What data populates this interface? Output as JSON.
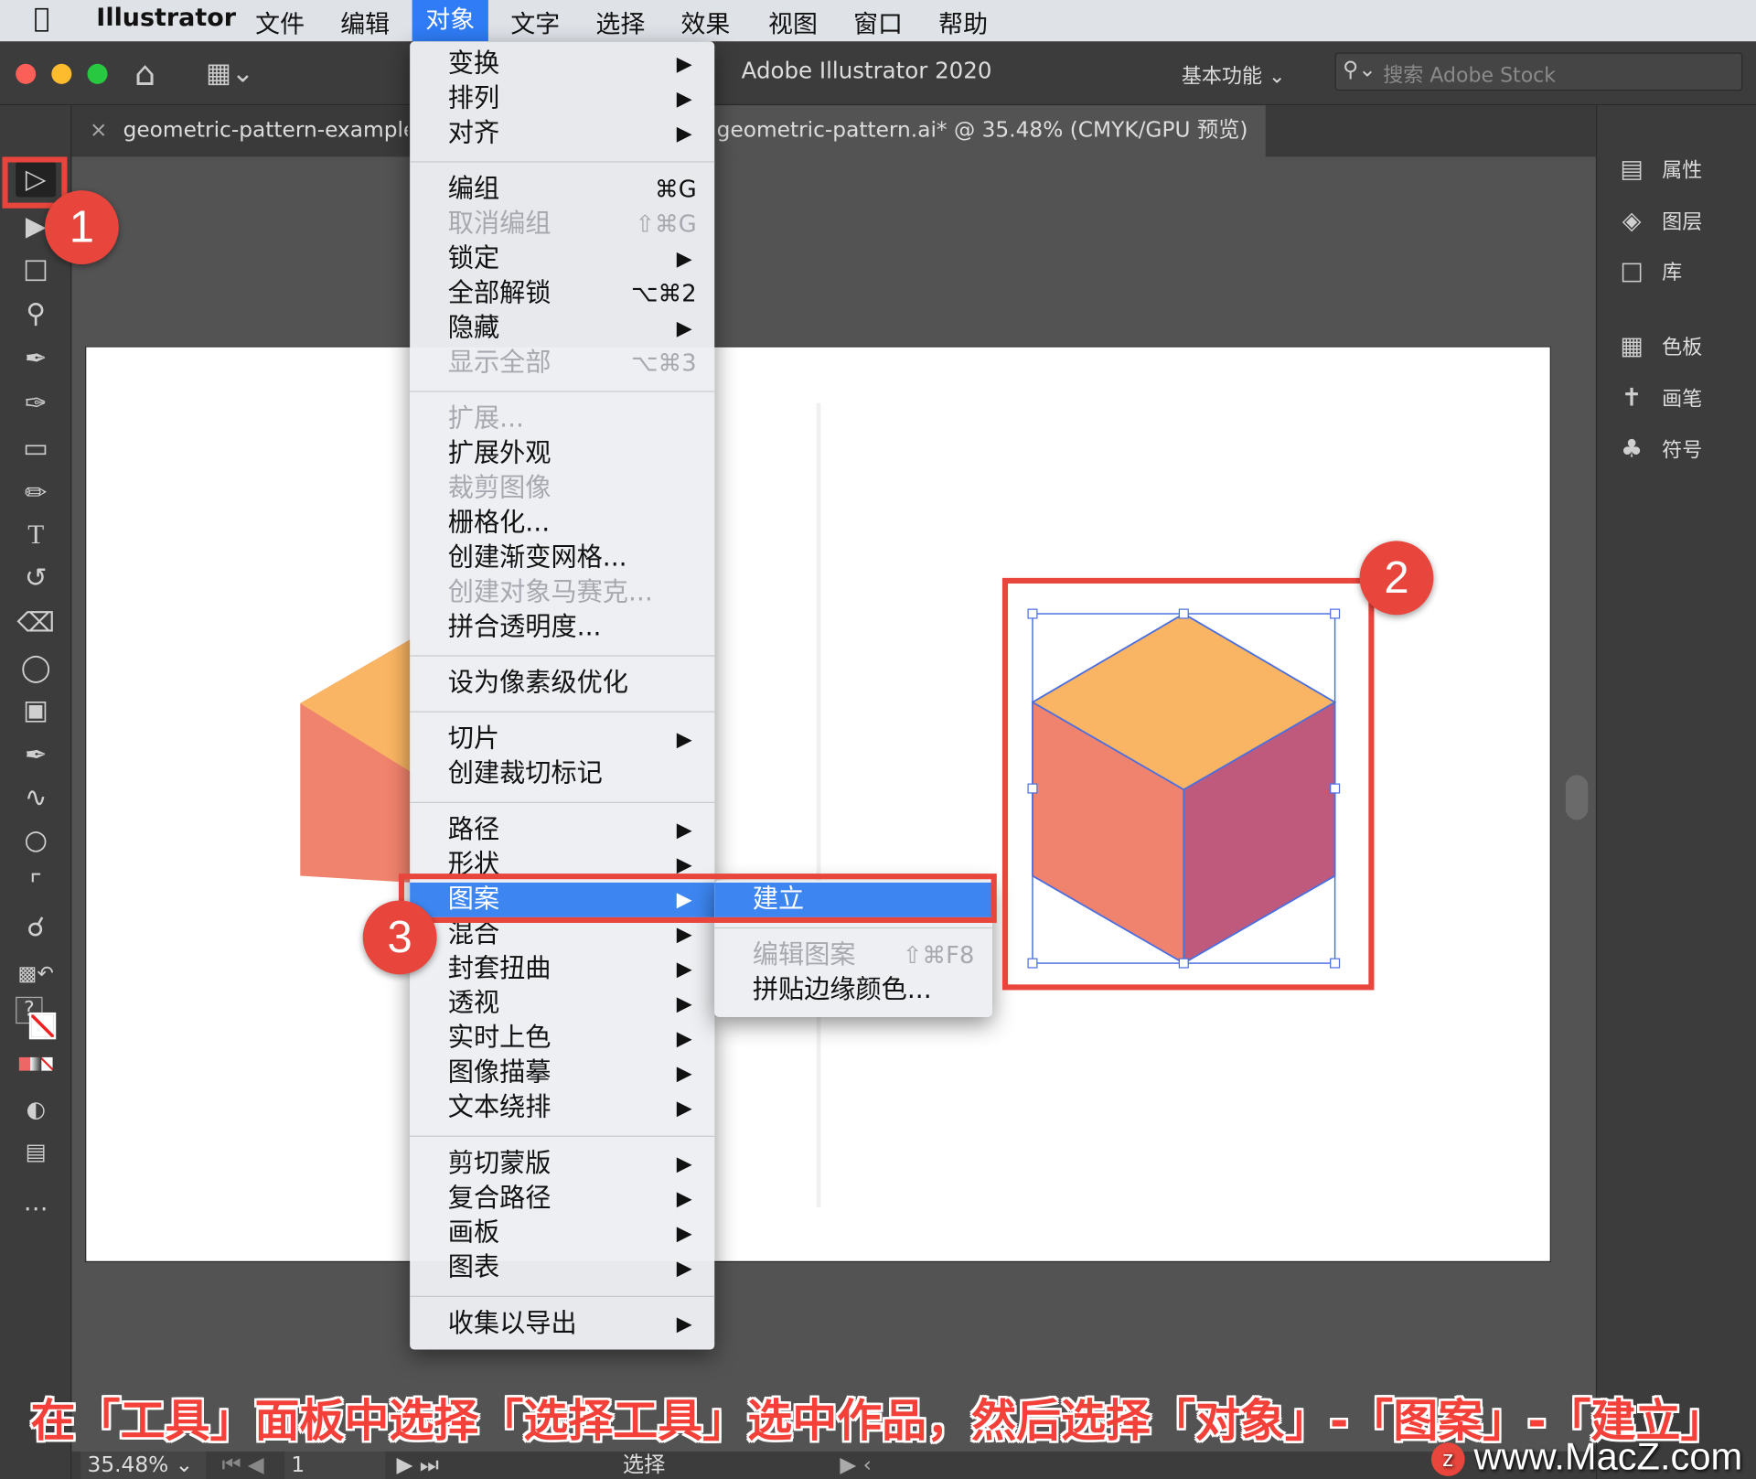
{
  "menubar": {
    "app_name": "Illustrator",
    "items": [
      "文件",
      "编辑",
      "对象",
      "文字",
      "选择",
      "效果",
      "视图",
      "窗口",
      "帮助"
    ]
  },
  "titlebar": {
    "title": "Adobe Illustrator 2020",
    "workspace": "基本功能",
    "search_placeholder": "搜索 Adobe Stock"
  },
  "tabs": [
    {
      "label": "geometric-pattern-examples.ai"
    },
    {
      "label": "geometric-pattern.ai* @ 35.48% (CMYK/GPU 预览)"
    }
  ],
  "right_panel": {
    "items": [
      "属性",
      "图层",
      "库",
      "色板",
      "画笔",
      "符号"
    ]
  },
  "object_menu": {
    "rows": [
      {
        "label": "变换",
        "sc": "▶"
      },
      {
        "label": "排列",
        "sc": "▶"
      },
      {
        "label": "对齐",
        "sc": "▶"
      },
      {
        "label": "编组",
        "sc": "⌘G"
      },
      {
        "label": "取消编组",
        "sc": "⇧⌘G",
        "dis": true
      },
      {
        "label": "锁定",
        "sc": "▶"
      },
      {
        "label": "全部解锁",
        "sc": "⌥⌘2"
      },
      {
        "label": "隐藏",
        "sc": "▶"
      },
      {
        "label": "显示全部",
        "sc": "⌥⌘3",
        "dis": true
      },
      {
        "label": "扩展...",
        "sc": "",
        "dis": true
      },
      {
        "label": "扩展外观",
        "sc": ""
      },
      {
        "label": "裁剪图像",
        "sc": "",
        "dis": true
      },
      {
        "label": "栅格化...",
        "sc": ""
      },
      {
        "label": "创建渐变网格...",
        "sc": ""
      },
      {
        "label": "创建对象马赛克...",
        "sc": "",
        "dis": true
      },
      {
        "label": "拼合透明度...",
        "sc": ""
      },
      {
        "label": "设为像素级优化",
        "sc": ""
      },
      {
        "label": "切片",
        "sc": "▶"
      },
      {
        "label": "创建裁切标记",
        "sc": ""
      },
      {
        "label": "路径",
        "sc": "▶"
      },
      {
        "label": "形状",
        "sc": "▶"
      },
      {
        "label": "图案",
        "sc": "▶",
        "hl": true
      },
      {
        "label": "混合",
        "sc": "▶"
      },
      {
        "label": "封套扭曲",
        "sc": "▶"
      },
      {
        "label": "透视",
        "sc": "▶"
      },
      {
        "label": "实时上色",
        "sc": "▶"
      },
      {
        "label": "图像描摹",
        "sc": "▶"
      },
      {
        "label": "文本绕排",
        "sc": "▶"
      },
      {
        "label": "剪切蒙版",
        "sc": "▶"
      },
      {
        "label": "复合路径",
        "sc": "▶"
      },
      {
        "label": "画板",
        "sc": "▶"
      },
      {
        "label": "图表",
        "sc": "▶"
      },
      {
        "label": "收集以导出",
        "sc": "▶"
      }
    ]
  },
  "pattern_submenu": {
    "rows": [
      {
        "label": "建立",
        "sc": "",
        "hl": true
      },
      {
        "label": "编辑图案",
        "sc": "⇧⌘F8",
        "dis": true
      },
      {
        "label": "拼贴边缘颜色...",
        "sc": ""
      }
    ]
  },
  "badges": [
    "1",
    "2",
    "3"
  ],
  "caption": "在「工具」面板中选择「选择工具」选中作品，然后选择「对象」-「图案」-「建立」",
  "statusbar": {
    "zoom": "35.48%",
    "page": "1",
    "tool": "选择"
  },
  "watermark": "www.MacZ.com",
  "colors": {
    "cube_top": "#f9b563",
    "cube_left": "#f0836d",
    "cube_right": "#c05a7c",
    "accent": "#e8453c",
    "menu_highlight": "#3d86f1"
  }
}
